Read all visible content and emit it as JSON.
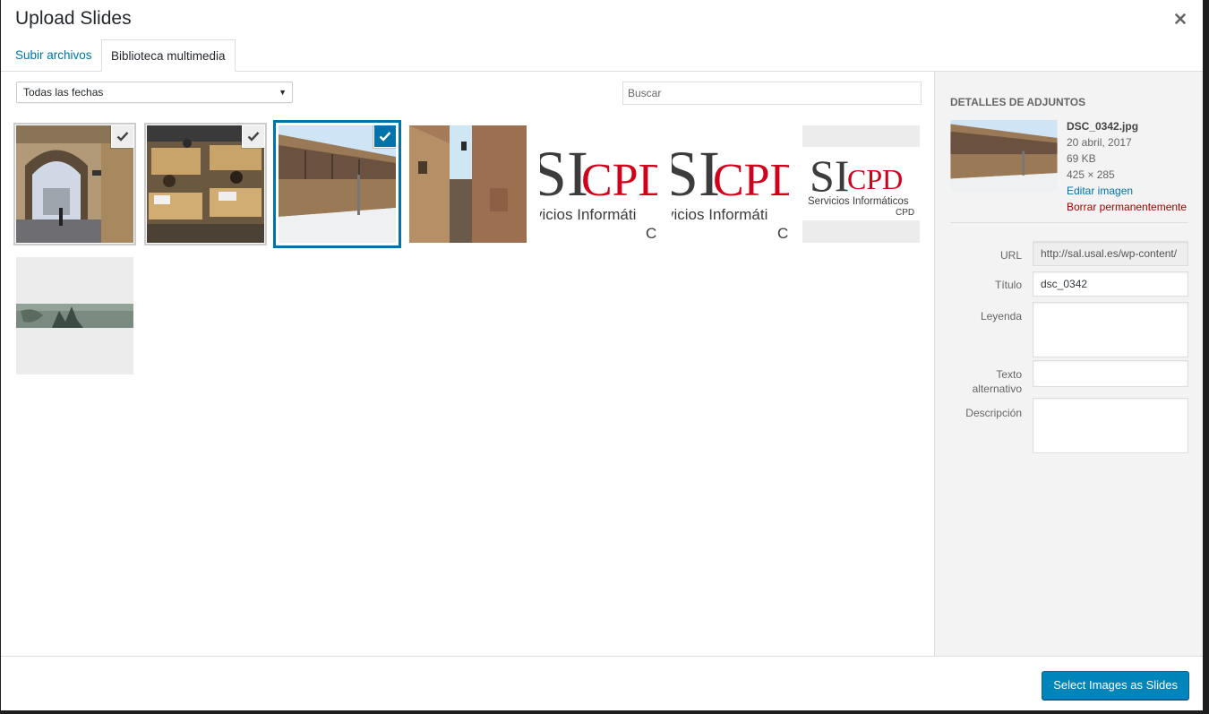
{
  "modal": {
    "title": "Upload Slides",
    "close_label": "×"
  },
  "tabs": [
    {
      "label": "Subir archivos"
    },
    {
      "label": "Biblioteca multimedia"
    }
  ],
  "filters": {
    "date_selected": "Todas las fechas",
    "search_placeholder": "Buscar"
  },
  "library": {
    "items": [
      {
        "desc": "arched street photo",
        "state": "selected"
      },
      {
        "desc": "students in library photo",
        "state": "selected"
      },
      {
        "desc": "long stone building photo",
        "state": "current"
      },
      {
        "desc": "narrow street photo",
        "state": "none"
      },
      {
        "desc": "SICPD logo large",
        "state": "none"
      },
      {
        "desc": "SICPD logo large",
        "state": "none"
      },
      {
        "desc": "SICPD logo",
        "state": "none"
      },
      {
        "desc": "stone carving banner",
        "state": "none"
      }
    ],
    "logo": {
      "si": "SI",
      "cpd": "CPD",
      "line1": "Servicios Informáticos",
      "line2": "CPD",
      "clipped_line": "vicios Informáti",
      "clipped_c": "C"
    }
  },
  "details": {
    "heading": "Detalles de adjuntos",
    "filename": "DSC_0342.jpg",
    "date": "20 abril, 2017",
    "size": "69 KB",
    "dimensions": "425 × 285",
    "edit_label": "Editar imagen",
    "delete_label": "Borrar permanentemente",
    "fields": {
      "url_label": "URL",
      "url_value": "http://sal.usal.es/wp-content/",
      "title_label": "Título",
      "title_value": "dsc_0342",
      "caption_label": "Leyenda",
      "caption_value": "",
      "alt_label_1": "Texto",
      "alt_label_2": "alternativo",
      "alt_value": "",
      "desc_label": "Descripción",
      "desc_value": ""
    }
  },
  "footer": {
    "primary_label": "Select Images as Slides"
  },
  "colors": {
    "accent": "#0073aa",
    "button": "#0085ba",
    "delete": "#a00000",
    "logo_red": "#d0021b"
  }
}
